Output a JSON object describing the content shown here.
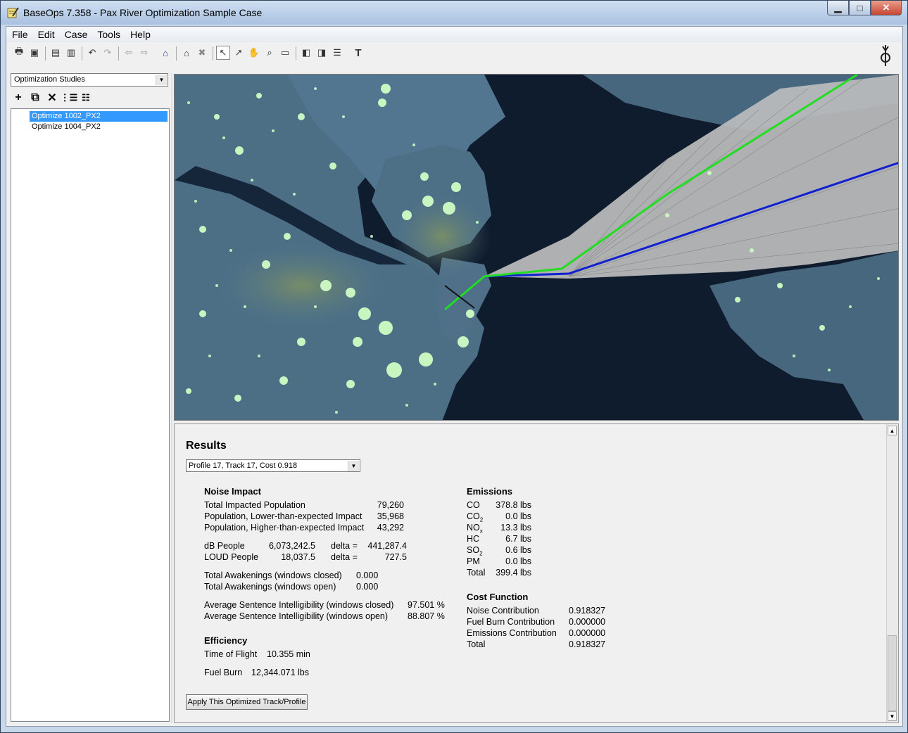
{
  "window": {
    "title": "BaseOps 7.358 - Pax River Optimization Sample Case",
    "min_label": "▁",
    "max_label": "□",
    "close_label": "✕"
  },
  "menu": [
    "File",
    "Edit",
    "Case",
    "Tools",
    "Help"
  ],
  "left_panel": {
    "selector": "Optimization Studies",
    "tools": [
      "add-icon",
      "copy-icon",
      "delete-icon",
      "expand-icon",
      "collapse-icon"
    ],
    "tree": [
      {
        "label": "Optimize 1002_PX2",
        "selected": true
      },
      {
        "label": "Optimize 1004_PX2",
        "selected": false
      }
    ]
  },
  "map": {
    "track_colors": {
      "optimized": "#22dd22",
      "original": "#1020d0"
    }
  },
  "results": {
    "title": "Results",
    "profile_selection": "Profile 17, Track 17, Cost 0.918",
    "noise": {
      "header": "Noise Impact",
      "total_impacted_label": "Total Impacted Population",
      "total_impacted_value": "79,260",
      "lower_label": "Population, Lower-than-expected Impact",
      "lower_value": "35,968",
      "higher_label": "Population, Higher-than-expected Impact",
      "higher_value": "43,292",
      "db_people_label": "dB People",
      "db_people_value": "6,073,242.5",
      "db_delta_label": "delta =",
      "db_delta_value": "441,287.4",
      "loud_people_label": "LOUD People",
      "loud_people_value": "18,037.5",
      "loud_delta_label": "delta =",
      "loud_delta_value": "727.5",
      "awak_closed_label": "Total Awakenings (windows closed)",
      "awak_closed_value": "0.000",
      "awak_open_label": "Total Awakenings (windows open)",
      "awak_open_value": "0.000",
      "asi_closed_label": "Average Sentence Intelligibility (windows closed)",
      "asi_closed_value": "97.501 %",
      "asi_open_label": "Average Sentence Intelligibility (windows open)",
      "asi_open_value": "88.807 %"
    },
    "efficiency": {
      "header": "Efficiency",
      "tof_label": "Time of Flight",
      "tof_value": "10.355 min",
      "fuel_label": "Fuel Burn",
      "fuel_value": "12,344.071 lbs"
    },
    "emissions": {
      "header": "Emissions",
      "rows": [
        {
          "name": "CO",
          "sub": "",
          "value": "378.8 lbs"
        },
        {
          "name": "CO",
          "sub": "2",
          "value": "0.0 lbs"
        },
        {
          "name": "NO",
          "sub": "x",
          "value": "13.3 lbs"
        },
        {
          "name": "HC",
          "sub": "",
          "value": "6.7 lbs"
        },
        {
          "name": "SO",
          "sub": "2",
          "value": "0.6 lbs"
        },
        {
          "name": "PM",
          "sub": "",
          "value": "0.0 lbs"
        },
        {
          "name": "Total",
          "sub": "",
          "value": "399.4 lbs"
        }
      ]
    },
    "cost": {
      "header": "Cost Function",
      "rows": [
        {
          "label": "Noise Contribution",
          "value": "0.918327"
        },
        {
          "label": "Fuel Burn Contribution",
          "value": "0.000000"
        },
        {
          "label": "Emissions Contribution",
          "value": "0.000000"
        },
        {
          "label": "Total",
          "value": "0.918327"
        }
      ]
    },
    "apply_button": "Apply This Optimized Track/Profile"
  }
}
